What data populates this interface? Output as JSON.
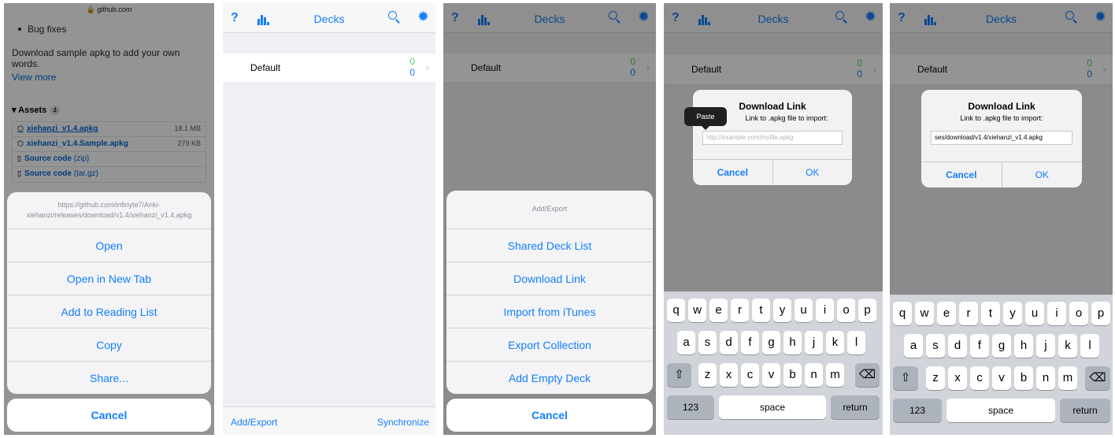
{
  "panel1": {
    "url": "🔒 github.com",
    "bullet": "Bug fixes",
    "description": "Download sample apkg to add your own words.",
    "view_more": "View more",
    "assets_title": "Assets",
    "assets_count": "4",
    "assets": [
      {
        "name": "xiehanzi_v1.4.apkg",
        "size": "18.1 MB"
      },
      {
        "name": "xiehanzi_v1.4.Sample.apkg",
        "size": "279 KB"
      },
      {
        "name": "Source code",
        "suffix": "(zip)"
      },
      {
        "name": "Source code",
        "suffix": "(tar.gz)"
      }
    ],
    "sheet_link": "https://github.com/infinyte7/Anki-xiehanzi/releases/download/v1.4/xiehanzi_v1.4.apkg",
    "sheet_items": [
      "Open",
      "Open in New Tab",
      "Add to Reading List",
      "Copy",
      "Share..."
    ],
    "cancel": "Cancel"
  },
  "app": {
    "help": "?",
    "title": "Decks",
    "deck_name": "Default",
    "new_count": "0",
    "due_count": "0",
    "add_export": "Add/Export",
    "synchronize": "Synchronize"
  },
  "panel3": {
    "sheet_title": "Add/Export",
    "items": [
      "Shared Deck List",
      "Download Link",
      "Import from iTunes",
      "Export Collection",
      "Add Empty Deck"
    ],
    "cancel": "Cancel"
  },
  "dialog": {
    "title": "Download Link",
    "message_a": "Link to .apkg file to import:",
    "message_b": "Link to .apkg file to import:",
    "placeholder": "http://example.com/myfile.apkg",
    "filled_value": "ses/download/v1.4/xiehanzi_v1.4.apkg",
    "cancel": "Cancel",
    "ok": "OK",
    "paste": "Paste"
  },
  "keyboard": {
    "row1": [
      "q",
      "w",
      "e",
      "r",
      "t",
      "y",
      "u",
      "i",
      "o",
      "p"
    ],
    "row2": [
      "a",
      "s",
      "d",
      "f",
      "g",
      "h",
      "j",
      "k",
      "l"
    ],
    "row3": [
      "z",
      "x",
      "c",
      "v",
      "b",
      "n",
      "m"
    ],
    "shift": "⇧",
    "delete": "⌫",
    "numbers": "123",
    "space": "space",
    "return": "return"
  },
  "colors": {
    "accent": "#147efb",
    "green": "#4cd964"
  }
}
